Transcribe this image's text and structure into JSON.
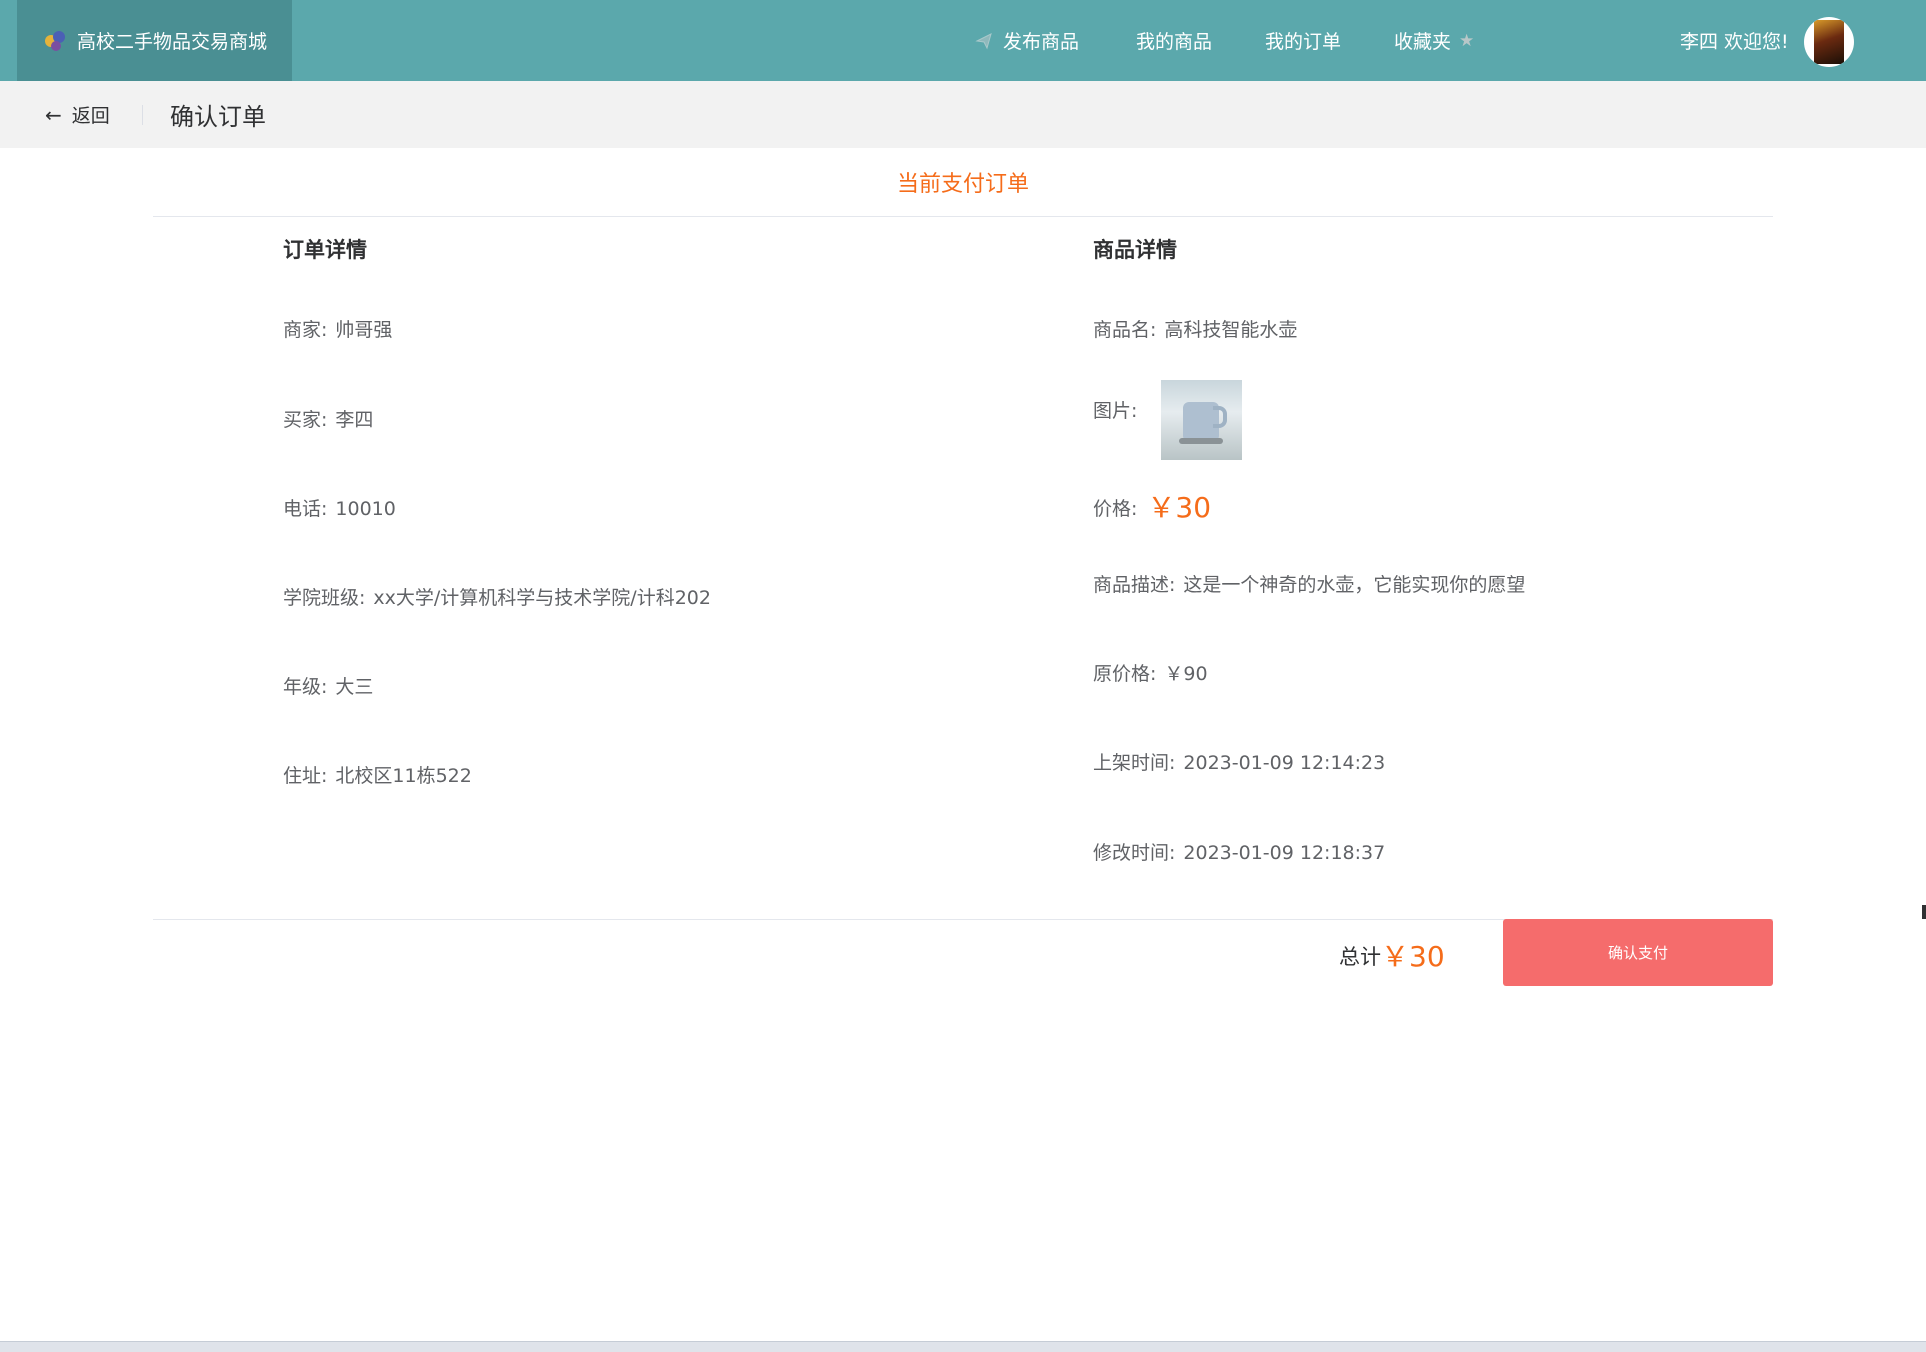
{
  "header": {
    "site_title": "高校二手物品交易商城",
    "nav": {
      "publish": "发布商品",
      "my_goods": "我的商品",
      "my_orders": "我的订单",
      "favorites": "收藏夹"
    },
    "greeting": "李四 欢迎您!"
  },
  "subheader": {
    "back_label": "返回",
    "page_title": "确认订单"
  },
  "order": {
    "section_title": "当前支付订单",
    "order_details": {
      "title": "订单详情",
      "seller_label": "商家:",
      "seller": "帅哥强",
      "buyer_label": "买家:",
      "buyer": "李四",
      "phone_label": "电话:",
      "phone": "10010",
      "college_label": "学院班级:",
      "college": "xx大学/计算机科学与技术学院/计科202",
      "grade_label": "年级:",
      "grade": "大三",
      "address_label": "住址:",
      "address": "北校区11栋522"
    },
    "goods_details": {
      "title": "商品详情",
      "name_label": "商品名:",
      "name": "高科技智能水壶",
      "image_label": "图片:",
      "price_label": "价格:",
      "price": "￥30",
      "desc_label": "商品描述:",
      "desc": "这是一个神奇的水壶，它能实现你的愿望",
      "original_price_label": "原价格:",
      "original_price": "￥90",
      "listed_label": "上架时间:",
      "listed_time": "2023-01-09 12:14:23",
      "modified_label": "修改时间:",
      "modified_time": "2023-01-09 12:18:37"
    },
    "total_label": "总计",
    "total": "￥30",
    "pay_button": "确认支付"
  },
  "colors": {
    "topbar": "#5ba8ac",
    "brand_bg": "#4a8f93",
    "accent_orange": "#f56c1a",
    "pay_button": "#f56c6c"
  }
}
